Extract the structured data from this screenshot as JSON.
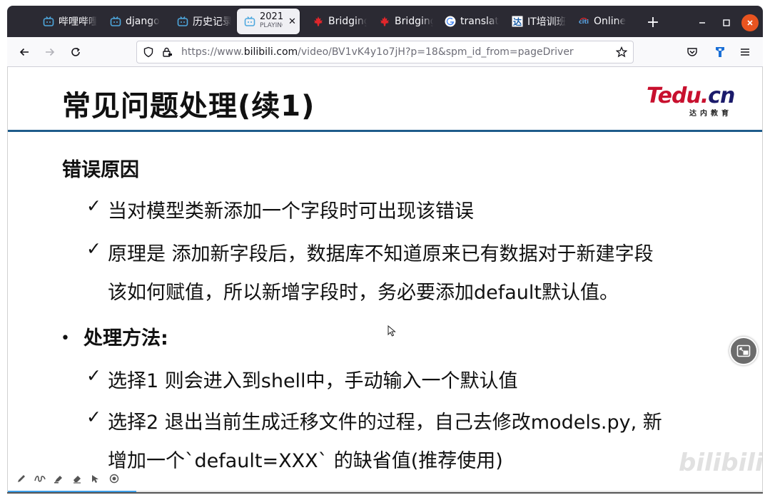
{
  "browser": {
    "tabs": [
      {
        "label": "哔哩哔哩",
        "icon": "bilibili-tv-icon",
        "active": false
      },
      {
        "label": "django",
        "icon": "bilibili-tv-icon",
        "active": false
      },
      {
        "label": "历史记录",
        "icon": "bilibili-tv-icon",
        "active": false
      },
      {
        "label": "2021",
        "sublabel": "PLAYING",
        "icon": "bilibili-tv-icon",
        "active": true
      },
      {
        "label": "Bridging",
        "icon": "maple-leaf-icon",
        "active": false
      },
      {
        "label": "Bridging",
        "icon": "maple-leaf-icon",
        "active": false
      },
      {
        "label": "translate",
        "icon": "google-g-icon",
        "active": false
      },
      {
        "label": "IT培训班",
        "icon": "tedu-da-icon",
        "active": false
      },
      {
        "label": "Online",
        "icon": "citi-icon",
        "active": false
      }
    ],
    "new_tab": "+",
    "url": {
      "prefix": "https://www.",
      "domain": "bilibili.com",
      "path": "/video/BV1vK4y1o7jH?p=18&spm_id_from=pageDriver"
    }
  },
  "slide": {
    "title": "常见问题处理(续1)",
    "logo": {
      "main": "Tedu.",
      "cn": "cn",
      "sub": "达内教育"
    },
    "section_heading": "错误原因",
    "reason_1": "当对模型类新添加一个字段时可出现该错误",
    "reason_2_line1": "原理是 添加新字段后，数据库不知道原来已有数据对于新建字段",
    "reason_2_line2": "该如何赋值，所以新增字段时，务必要添加default默认值。",
    "bullet": "•",
    "method_heading": "处理方法:",
    "method_1": "选择1 则会进入到shell中，手动输入一个默认值",
    "method_2_line1": "选择2 退出当前生成迁移文件的过程，自己去修改models.py, 新",
    "method_2_line2": "增加一个`default=XXX` 的缺省值(推荐使用)",
    "check": "✓"
  },
  "player": {
    "watermark": "bilibili",
    "progress": 0.17
  },
  "colors": {
    "tab_strip": "#2b2a33",
    "title_rule": "#1f5c8b",
    "logo_red": "#c8102e",
    "progress": "#3e9ee8",
    "window_close": "#e95420"
  }
}
